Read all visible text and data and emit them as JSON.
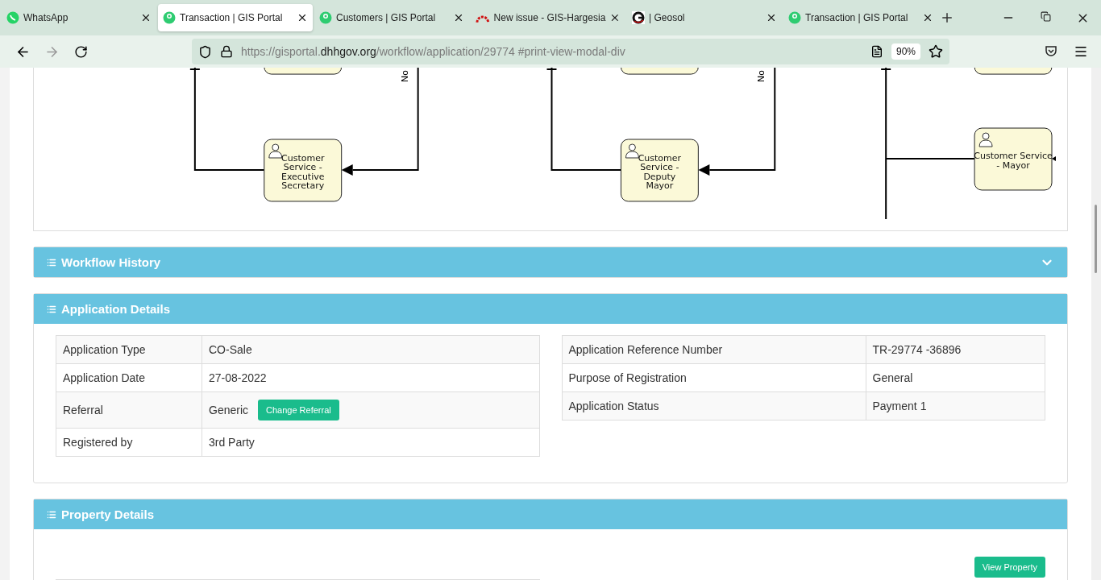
{
  "browser": {
    "tabs": [
      {
        "title": "WhatsApp",
        "selected": false
      },
      {
        "title": "Transaction | GIS Portal",
        "selected": true
      },
      {
        "title": "Customers | GIS Portal",
        "selected": false
      },
      {
        "title": "New issue - GIS-Hargesia",
        "selected": false
      },
      {
        "title": "| Geosol",
        "selected": false
      },
      {
        "title": "Transaction | GIS Portal",
        "selected": false
      }
    ],
    "url": {
      "prefix": "https://gisportal.",
      "host": "dhhgov.org",
      "path": "/workflow/application/29774 #print-view-modal-div"
    },
    "zoom": "90%"
  },
  "diagram": {
    "nodes": [
      "Customer Service - Executive Secretary",
      "Customer Service - Deputy Mayor",
      "Customer Service - Mayor"
    ],
    "edge_labels": [
      "No",
      "No"
    ]
  },
  "workflow_history": {
    "title": "Workflow History",
    "expanded": false
  },
  "application_details": {
    "title": "Application Details",
    "left_rows": [
      {
        "label": "Application Type",
        "value": "CO-Sale"
      },
      {
        "label": "Application Date",
        "value": "27-08-2022"
      },
      {
        "label": "Referral",
        "value": "Generic",
        "button": "Change Referral"
      },
      {
        "label": "Registered by",
        "value": "3rd Party"
      }
    ],
    "right_rows": [
      {
        "label": "Application Reference Number",
        "value": "TR-29774 -36896"
      },
      {
        "label": "Purpose of Registration",
        "value": "General"
      },
      {
        "label": "Application Status",
        "value": "Payment 1"
      }
    ]
  },
  "property_details": {
    "title": "Property Details",
    "button": "View Property"
  }
}
